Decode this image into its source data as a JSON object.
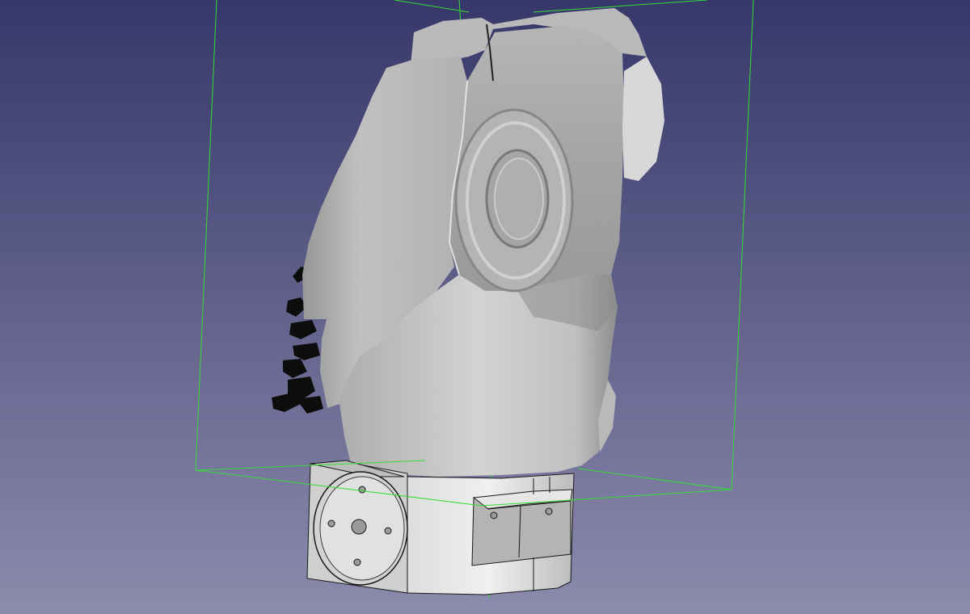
{
  "viewport": {
    "background_top": "#37376a",
    "background_bottom": "#8b8bad"
  },
  "colors": {
    "bounding_box": "#33dd33",
    "mesh_light": "#d0d0d0",
    "mesh_mid": "#b3b3b3",
    "mesh_dark": "#8e8e8e",
    "mesh_shadow": "#6f6f6f",
    "base_light": "#ececec",
    "base_mid": "#d6d6d6",
    "base_dark": "#a9a9a9",
    "edge": "#1a1a1a",
    "scan_noise": "#0a0a0a"
  },
  "objects": [
    {
      "name": "scanned-mesh",
      "icon": "scanned-robot-arm-mesh"
    },
    {
      "name": "cad-base-part",
      "icon": "cad-solid-base"
    },
    {
      "name": "selection-bounding-box",
      "icon": "wireframe-box"
    }
  ]
}
